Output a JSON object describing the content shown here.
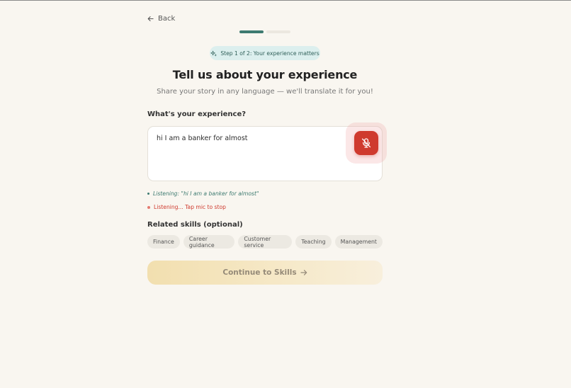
{
  "nav": {
    "back_label": "Back"
  },
  "progress": {
    "current_step": 1,
    "total_steps": 2
  },
  "step_badge": {
    "text": "Step 1 of 2: Your experience matters"
  },
  "heading": {
    "title": "Tell us about your experience",
    "subtitle": "Share your story in any language — we'll translate it for you!"
  },
  "experience": {
    "label": "What's your experience?",
    "value": "hi I am a banker for almost"
  },
  "status": {
    "transcript": "Listening: \"hi I am a banker for almost\"",
    "hint": "Listening... Tap mic to stop"
  },
  "skills": {
    "label": "Related skills (optional)",
    "chips": [
      "Finance",
      "Career guidance",
      "Customer service",
      "Teaching",
      "Management"
    ]
  },
  "continue": {
    "label": "Continue to Skills"
  },
  "colors": {
    "background": "#f9f6f0",
    "accent": "#3d7a70",
    "mic_red": "#cf3a2e",
    "badge_bg": "#dcefee",
    "cta_gradient_start": "#f2dfaf"
  },
  "icons": {
    "back": "arrow-left-icon",
    "badge": "sparkle-icon",
    "mic": "mic-off-icon",
    "continue": "arrow-right-icon"
  }
}
